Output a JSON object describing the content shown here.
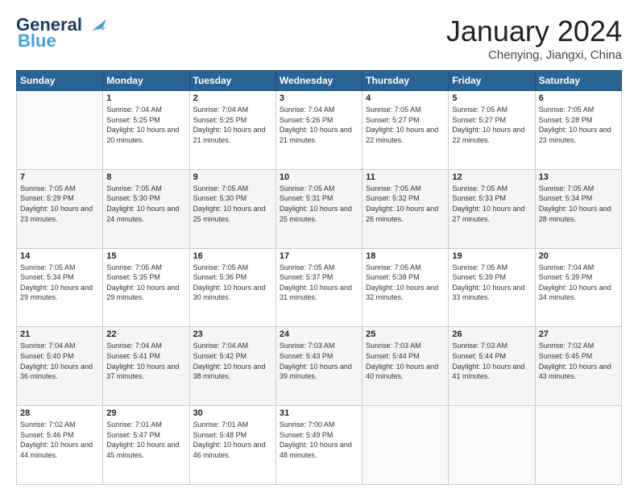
{
  "header": {
    "logo_general": "General",
    "logo_blue": "Blue",
    "month_title": "January 2024",
    "location": "Chenying, Jiangxi, China"
  },
  "weekdays": [
    "Sunday",
    "Monday",
    "Tuesday",
    "Wednesday",
    "Thursday",
    "Friday",
    "Saturday"
  ],
  "weeks": [
    [
      {
        "day": "",
        "sunrise": "",
        "sunset": "",
        "daylight": ""
      },
      {
        "day": "1",
        "sunrise": "Sunrise: 7:04 AM",
        "sunset": "Sunset: 5:25 PM",
        "daylight": "Daylight: 10 hours and 20 minutes."
      },
      {
        "day": "2",
        "sunrise": "Sunrise: 7:04 AM",
        "sunset": "Sunset: 5:25 PM",
        "daylight": "Daylight: 10 hours and 21 minutes."
      },
      {
        "day": "3",
        "sunrise": "Sunrise: 7:04 AM",
        "sunset": "Sunset: 5:26 PM",
        "daylight": "Daylight: 10 hours and 21 minutes."
      },
      {
        "day": "4",
        "sunrise": "Sunrise: 7:05 AM",
        "sunset": "Sunset: 5:27 PM",
        "daylight": "Daylight: 10 hours and 22 minutes."
      },
      {
        "day": "5",
        "sunrise": "Sunrise: 7:05 AM",
        "sunset": "Sunset: 5:27 PM",
        "daylight": "Daylight: 10 hours and 22 minutes."
      },
      {
        "day": "6",
        "sunrise": "Sunrise: 7:05 AM",
        "sunset": "Sunset: 5:28 PM",
        "daylight": "Daylight: 10 hours and 23 minutes."
      }
    ],
    [
      {
        "day": "7",
        "sunrise": "Sunrise: 7:05 AM",
        "sunset": "Sunset: 5:29 PM",
        "daylight": "Daylight: 10 hours and 23 minutes."
      },
      {
        "day": "8",
        "sunrise": "Sunrise: 7:05 AM",
        "sunset": "Sunset: 5:30 PM",
        "daylight": "Daylight: 10 hours and 24 minutes."
      },
      {
        "day": "9",
        "sunrise": "Sunrise: 7:05 AM",
        "sunset": "Sunset: 5:30 PM",
        "daylight": "Daylight: 10 hours and 25 minutes."
      },
      {
        "day": "10",
        "sunrise": "Sunrise: 7:05 AM",
        "sunset": "Sunset: 5:31 PM",
        "daylight": "Daylight: 10 hours and 25 minutes."
      },
      {
        "day": "11",
        "sunrise": "Sunrise: 7:05 AM",
        "sunset": "Sunset: 5:32 PM",
        "daylight": "Daylight: 10 hours and 26 minutes."
      },
      {
        "day": "12",
        "sunrise": "Sunrise: 7:05 AM",
        "sunset": "Sunset: 5:33 PM",
        "daylight": "Daylight: 10 hours and 27 minutes."
      },
      {
        "day": "13",
        "sunrise": "Sunrise: 7:05 AM",
        "sunset": "Sunset: 5:34 PM",
        "daylight": "Daylight: 10 hours and 28 minutes."
      }
    ],
    [
      {
        "day": "14",
        "sunrise": "Sunrise: 7:05 AM",
        "sunset": "Sunset: 5:34 PM",
        "daylight": "Daylight: 10 hours and 29 minutes."
      },
      {
        "day": "15",
        "sunrise": "Sunrise: 7:05 AM",
        "sunset": "Sunset: 5:35 PM",
        "daylight": "Daylight: 10 hours and 29 minutes."
      },
      {
        "day": "16",
        "sunrise": "Sunrise: 7:05 AM",
        "sunset": "Sunset: 5:36 PM",
        "daylight": "Daylight: 10 hours and 30 minutes."
      },
      {
        "day": "17",
        "sunrise": "Sunrise: 7:05 AM",
        "sunset": "Sunset: 5:37 PM",
        "daylight": "Daylight: 10 hours and 31 minutes."
      },
      {
        "day": "18",
        "sunrise": "Sunrise: 7:05 AM",
        "sunset": "Sunset: 5:38 PM",
        "daylight": "Daylight: 10 hours and 32 minutes."
      },
      {
        "day": "19",
        "sunrise": "Sunrise: 7:05 AM",
        "sunset": "Sunset: 5:39 PM",
        "daylight": "Daylight: 10 hours and 33 minutes."
      },
      {
        "day": "20",
        "sunrise": "Sunrise: 7:04 AM",
        "sunset": "Sunset: 5:39 PM",
        "daylight": "Daylight: 10 hours and 34 minutes."
      }
    ],
    [
      {
        "day": "21",
        "sunrise": "Sunrise: 7:04 AM",
        "sunset": "Sunset: 5:40 PM",
        "daylight": "Daylight: 10 hours and 36 minutes."
      },
      {
        "day": "22",
        "sunrise": "Sunrise: 7:04 AM",
        "sunset": "Sunset: 5:41 PM",
        "daylight": "Daylight: 10 hours and 37 minutes."
      },
      {
        "day": "23",
        "sunrise": "Sunrise: 7:04 AM",
        "sunset": "Sunset: 5:42 PM",
        "daylight": "Daylight: 10 hours and 38 minutes."
      },
      {
        "day": "24",
        "sunrise": "Sunrise: 7:03 AM",
        "sunset": "Sunset: 5:43 PM",
        "daylight": "Daylight: 10 hours and 39 minutes."
      },
      {
        "day": "25",
        "sunrise": "Sunrise: 7:03 AM",
        "sunset": "Sunset: 5:44 PM",
        "daylight": "Daylight: 10 hours and 40 minutes."
      },
      {
        "day": "26",
        "sunrise": "Sunrise: 7:03 AM",
        "sunset": "Sunset: 5:44 PM",
        "daylight": "Daylight: 10 hours and 41 minutes."
      },
      {
        "day": "27",
        "sunrise": "Sunrise: 7:02 AM",
        "sunset": "Sunset: 5:45 PM",
        "daylight": "Daylight: 10 hours and 43 minutes."
      }
    ],
    [
      {
        "day": "28",
        "sunrise": "Sunrise: 7:02 AM",
        "sunset": "Sunset: 5:46 PM",
        "daylight": "Daylight: 10 hours and 44 minutes."
      },
      {
        "day": "29",
        "sunrise": "Sunrise: 7:01 AM",
        "sunset": "Sunset: 5:47 PM",
        "daylight": "Daylight: 10 hours and 45 minutes."
      },
      {
        "day": "30",
        "sunrise": "Sunrise: 7:01 AM",
        "sunset": "Sunset: 5:48 PM",
        "daylight": "Daylight: 10 hours and 46 minutes."
      },
      {
        "day": "31",
        "sunrise": "Sunrise: 7:00 AM",
        "sunset": "Sunset: 5:49 PM",
        "daylight": "Daylight: 10 hours and 48 minutes."
      },
      {
        "day": "",
        "sunrise": "",
        "sunset": "",
        "daylight": ""
      },
      {
        "day": "",
        "sunrise": "",
        "sunset": "",
        "daylight": ""
      },
      {
        "day": "",
        "sunrise": "",
        "sunset": "",
        "daylight": ""
      }
    ]
  ]
}
